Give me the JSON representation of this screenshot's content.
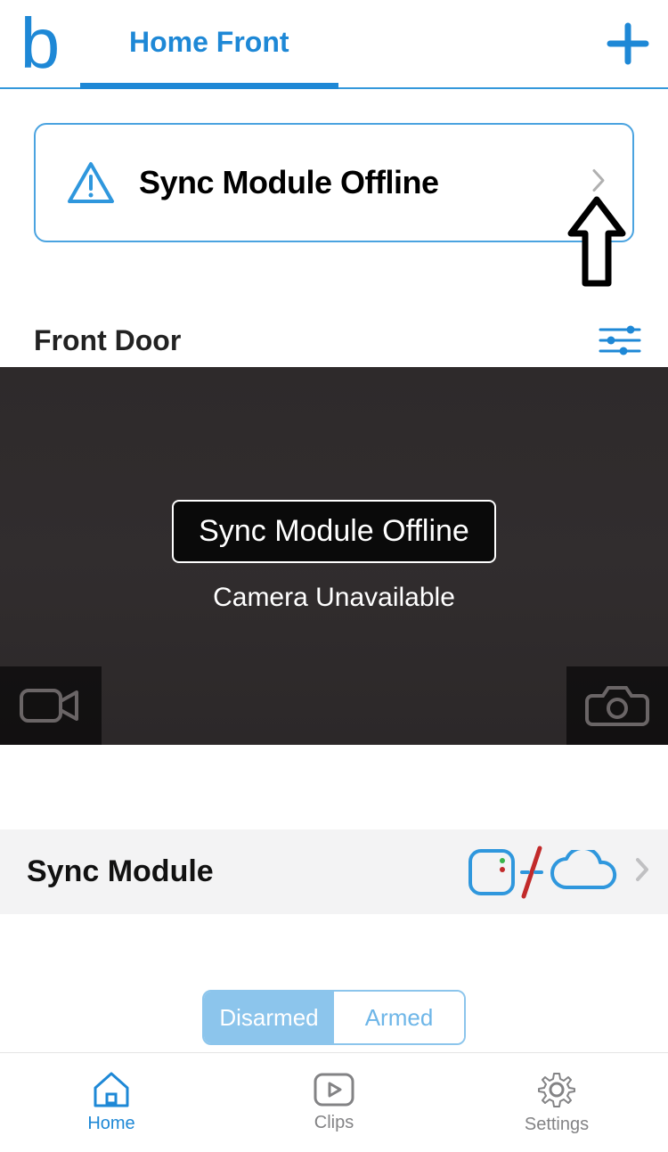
{
  "header": {
    "system_tab": "Home Front"
  },
  "alert": {
    "title": "Sync Module Offline"
  },
  "camera": {
    "name": "Front Door",
    "offline_badge": "Sync Module Offline",
    "unavailable_text": "Camera Unavailable"
  },
  "sync_module": {
    "title": "Sync Module"
  },
  "arm": {
    "disarmed": "Disarmed",
    "armed": "Armed",
    "active": "disarmed"
  },
  "tabs": {
    "home": "Home",
    "clips": "Clips",
    "settings": "Settings"
  },
  "colors": {
    "accent": "#1e88d6",
    "alert_red": "#c22a2a"
  }
}
